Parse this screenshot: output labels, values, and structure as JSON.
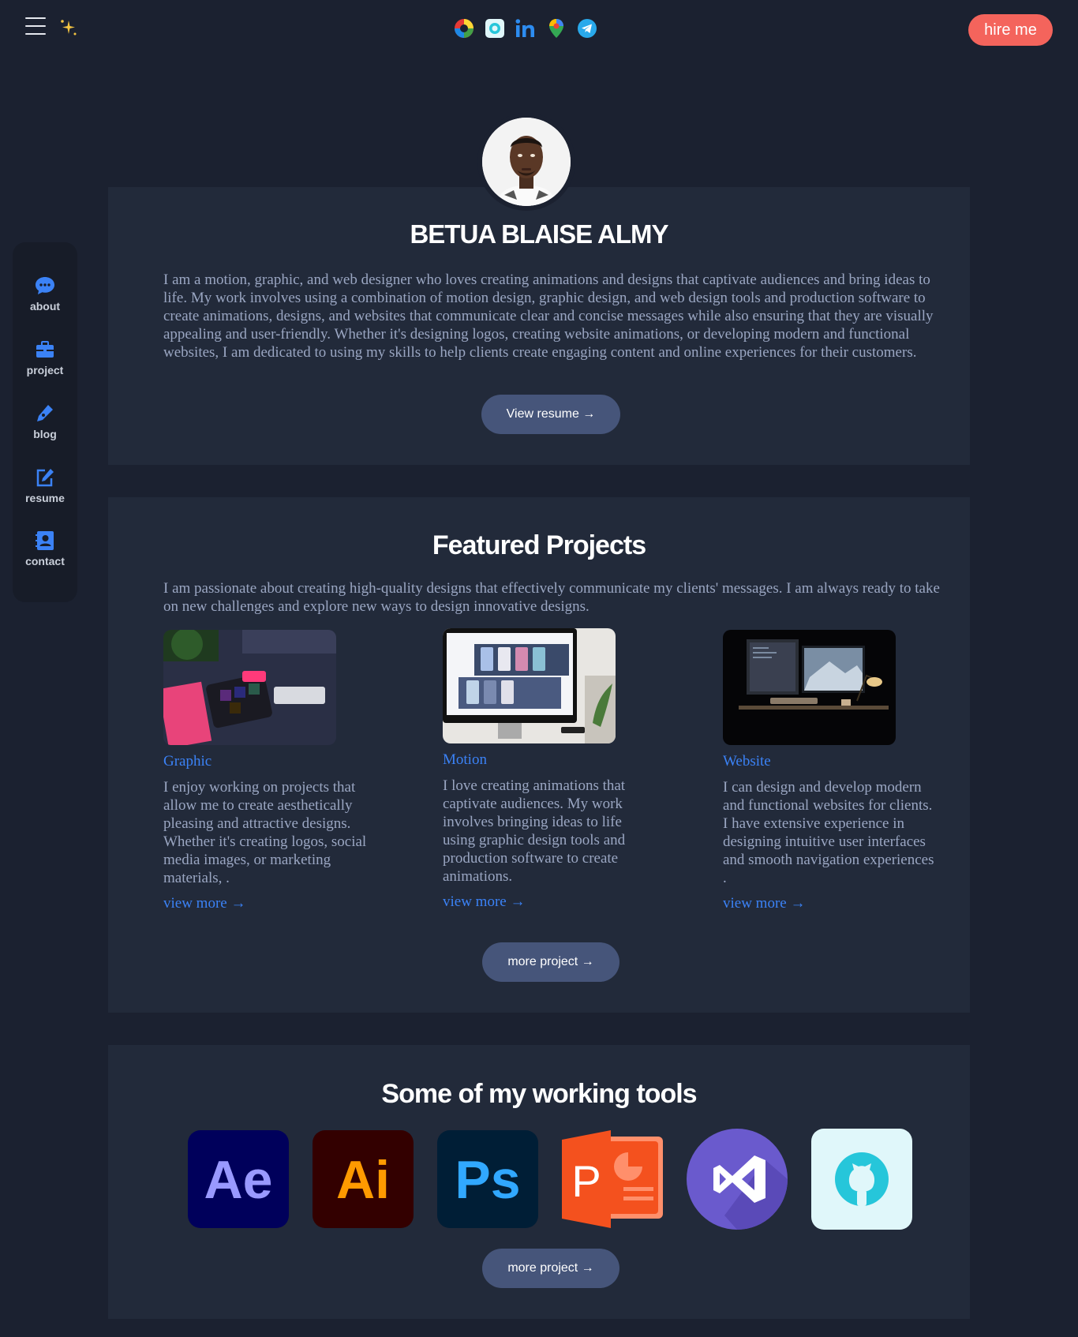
{
  "header": {
    "hire_label": "hire me",
    "social_icons": [
      "color-wheel-icon",
      "github-icon",
      "linkedin-icon",
      "map-pin-icon",
      "telegram-icon"
    ]
  },
  "sidebar": {
    "items": [
      {
        "label": "about",
        "icon": "chat-bubble-icon"
      },
      {
        "label": "project",
        "icon": "briefcase-icon"
      },
      {
        "label": "blog",
        "icon": "pen-icon"
      },
      {
        "label": "resume",
        "icon": "edit-icon"
      },
      {
        "label": "contact",
        "icon": "contact-book-icon"
      }
    ]
  },
  "profile": {
    "name": "BETUA BLAISE ALMY",
    "bio": "I am a motion, graphic, and web designer who loves creating animations and designs that captivate audiences and bring ideas to life. My work involves using a combination of motion design, graphic design, and web design tools and production software to create animations, designs, and websites that communicate clear and concise messages while also ensuring that they are visually appealing and user-friendly. Whether it's designing logos, creating website animations, or developing modern and functional websites, I am dedicated to using my skills to help clients create engaging content and online experiences for their customers.",
    "resume_button": "View resume →"
  },
  "projects": {
    "title": "Featured Projects",
    "intro": "I am passionate about creating high-quality designs that effectively communicate my clients' messages. I am always ready to take on new challenges and explore new ways to design innovative designs.",
    "cards": [
      {
        "title": "Graphic",
        "text": "I enjoy working on projects that allow me to create aesthetically pleasing and attractive designs. Whether it's creating logos, social media images, or marketing materials, .",
        "link": "view more →"
      },
      {
        "title": "Motion",
        "text": "I love creating animations that captivate audiences. My work involves bringing ideas to life using graphic design tools and production software to create animations.",
        "link": "view more →"
      },
      {
        "title": "Website",
        "text": "I can design and develop modern and functional websites for clients. I have extensive experience in designing intuitive user interfaces and smooth navigation experiences .",
        "link": "view more →"
      }
    ],
    "more_button": "more project →"
  },
  "tools": {
    "title": "Some of my working tools",
    "items": [
      {
        "icon": "after-effects-icon",
        "text": "Ae",
        "bg": "#00005b",
        "fg": "#9999ff"
      },
      {
        "icon": "illustrator-icon",
        "text": "Ai",
        "bg": "#330000",
        "fg": "#ff9a00"
      },
      {
        "icon": "photoshop-icon",
        "text": "Ps",
        "bg": "#001e36",
        "fg": "#31a8ff"
      },
      {
        "icon": "powerpoint-icon",
        "text": "P",
        "bg": "#f4511e",
        "fg": "#ffffff"
      },
      {
        "icon": "visual-studio-icon",
        "text": "",
        "bg": "#6a5acd",
        "fg": "#ffffff"
      },
      {
        "icon": "github-icon",
        "text": "",
        "bg": "#e0f7fa",
        "fg": "#26c6da"
      }
    ],
    "more_button": "more project →"
  },
  "colors": {
    "background": "#1b2130",
    "panel": "#222a3a",
    "accent": "#3b82f6",
    "hire": "#f4645c",
    "button": "#46557a"
  }
}
